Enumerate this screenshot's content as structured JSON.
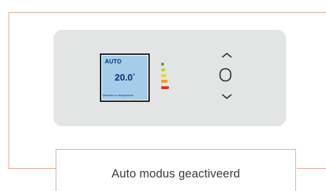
{
  "thermostat": {
    "mode": "AUTO",
    "temperature": "20.0",
    "temperature_unit": "°",
    "status_text": "Maintien en température",
    "energy_scale": {
      "icon": "energy-level-icon",
      "colors": [
        "#3aa842",
        "#b8d435",
        "#f4d21f",
        "#f09a1f",
        "#e03224"
      ]
    },
    "controls": {
      "up_icon": "chevron-up-icon",
      "center_icon": "select-button-icon",
      "down_icon": "chevron-down-icon"
    }
  },
  "caption": {
    "text": "Auto modus geactiveerd"
  },
  "colors": {
    "frame_accent": "#e8a58f",
    "panel": "#e3e5e5",
    "lcd_background": "#a4cdea",
    "lcd_text": "#0c2a7a"
  }
}
